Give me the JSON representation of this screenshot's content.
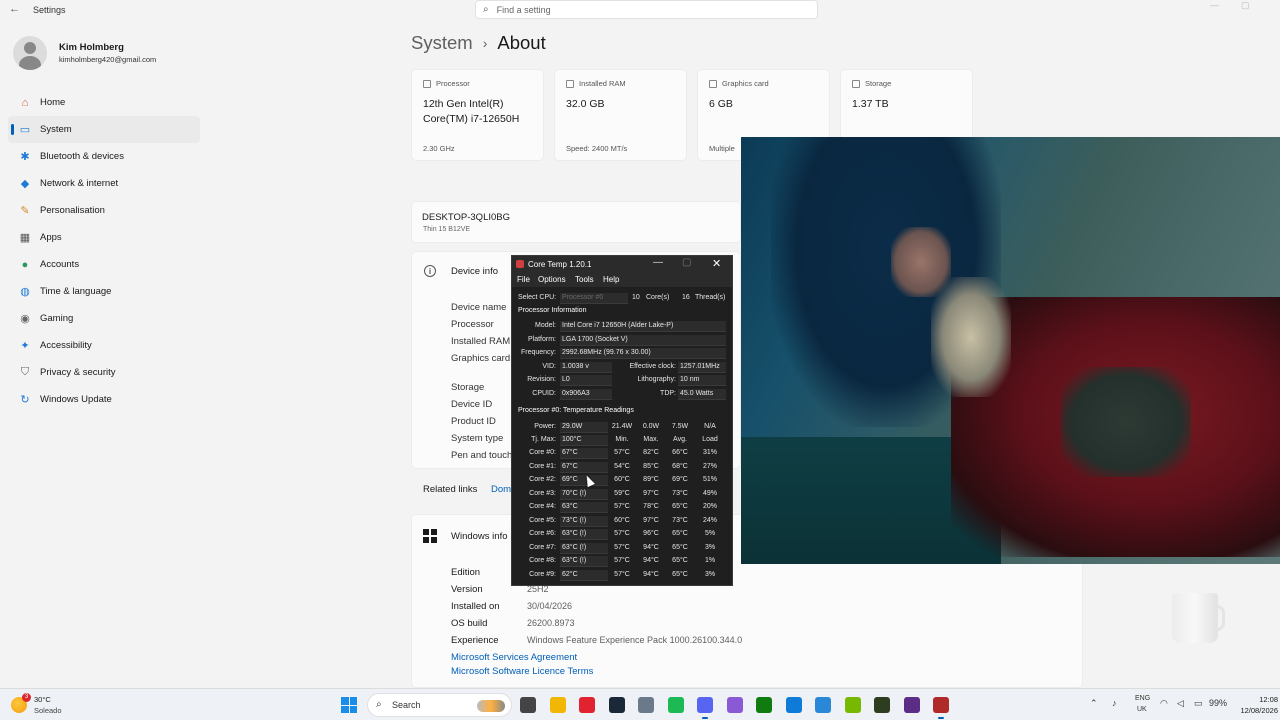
{
  "app": {
    "title": "Settings",
    "back_icon": "←"
  },
  "search": {
    "placeholder": "Find a setting"
  },
  "user": {
    "name": "Kim Holmberg",
    "email": "kimholmberg420@gmail.com"
  },
  "sidebar": {
    "items": [
      {
        "label": "Home",
        "icon": "home-icon",
        "glyph": "⌂",
        "color": "#d9623a"
      },
      {
        "label": "System",
        "icon": "system-icon",
        "glyph": "▭",
        "color": "#1f7ad6",
        "active": true
      },
      {
        "label": "Bluetooth & devices",
        "icon": "bluetooth-icon",
        "glyph": "✱",
        "color": "#1f7ad6"
      },
      {
        "label": "Network & internet",
        "icon": "network-icon",
        "glyph": "◆",
        "color": "#1f7ad6"
      },
      {
        "label": "Personalisation",
        "icon": "brush-icon",
        "glyph": "✎",
        "color": "#d08a2a"
      },
      {
        "label": "Apps",
        "icon": "apps-icon",
        "glyph": "▦",
        "color": "#555555"
      },
      {
        "label": "Accounts",
        "icon": "accounts-icon",
        "glyph": "●",
        "color": "#2a9a5a"
      },
      {
        "label": "Time & language",
        "icon": "globe-icon",
        "glyph": "◍",
        "color": "#1f7ad6"
      },
      {
        "label": "Gaming",
        "icon": "gaming-icon",
        "glyph": "◉",
        "color": "#666666"
      },
      {
        "label": "Accessibility",
        "icon": "accessibility-icon",
        "glyph": "✦",
        "color": "#1f7ad6"
      },
      {
        "label": "Privacy & security",
        "icon": "shield-icon",
        "glyph": "⛉",
        "color": "#666666"
      },
      {
        "label": "Windows Update",
        "icon": "update-icon",
        "glyph": "↻",
        "color": "#1f7ad6"
      }
    ]
  },
  "breadcrumb": {
    "parent": "System",
    "separator": "›",
    "current": "About"
  },
  "cards": [
    {
      "title": "Processor",
      "value": "12th Gen Intel(R) Core(TM) i7-12650H",
      "sub": "2.30 GHz"
    },
    {
      "title": "Installed RAM",
      "value": "32.0 GB",
      "sub": "Speed: 2400 MT/s"
    },
    {
      "title": "Graphics card",
      "value": "6 GB",
      "sub": "Multiple"
    },
    {
      "title": "Storage",
      "value": "1.37 TB",
      "sub": ""
    }
  ],
  "device": {
    "name": "DESKTOP-3QLI0BG",
    "model": "Thin 15 B12VE",
    "info_label": "Device info",
    "specs": [
      "Device name",
      "Processor",
      "Installed RAM",
      "Graphics card",
      "Storage",
      "Device ID",
      "Product ID",
      "System type",
      "Pen and touch"
    ]
  },
  "related": {
    "label": "Related links",
    "link": "Dom"
  },
  "windows_info": {
    "label": "Windows info",
    "rows": [
      {
        "label": "Edition",
        "value": ""
      },
      {
        "label": "Version",
        "value": "25H2"
      },
      {
        "label": "Installed on",
        "value": "30/04/2026"
      },
      {
        "label": "OS build",
        "value": "26200.8973"
      },
      {
        "label": "Experience",
        "value": "Windows Feature Experience Pack 1000.26100.344.0"
      }
    ],
    "links": [
      "Microsoft Services Agreement",
      "Microsoft Software Licence Terms"
    ]
  },
  "coretemp": {
    "title": "Core Temp 1.20.1",
    "menu": [
      "File",
      "Options",
      "Tools",
      "Help"
    ],
    "select_cpu_label": "Select CPU:",
    "select_cpu_value": "Processor #0",
    "cores": "10",
    "cores_label": "Core(s)",
    "threads": "16",
    "threads_label": "Thread(s)",
    "proc_info_header": "Processor Information",
    "model_label": "Model:",
    "model": "Intel Core i7 12650H (Alder Lake-P)",
    "platform_label": "Platform:",
    "platform": "LGA 1700 (Socket V)",
    "frequency_label": "Frequency:",
    "frequency": "2992.68MHz (99.76 x 30.00)",
    "vid_label": "VID:",
    "vid": "1.0038 v",
    "eff_clock_label": "Effective clock:",
    "eff_clock": "1257.01MHz",
    "revision_label": "Revision:",
    "revision": "L0",
    "litho_label": "Lithography:",
    "litho": "10 nm",
    "cpuid_label": "CPUID:",
    "cpuid": "0x906A3",
    "tdp_label": "TDP:",
    "tdp": "45.0 Watts",
    "temp_header": "Processor #0: Temperature Readings",
    "power_label": "Power:",
    "power": [
      "29.0W",
      "21.4W",
      "0.0W",
      "7.5W",
      "N/A"
    ],
    "tjmax_label": "Tj. Max:",
    "tjmax": "100°C",
    "col_headers": [
      "Min.",
      "Max.",
      "Avg.",
      "Load"
    ],
    "cores_data": [
      {
        "label": "Core #0:",
        "temp": "67°C",
        "min": "57°C",
        "max": "82°C",
        "avg": "66°C",
        "load": "31%"
      },
      {
        "label": "Core #1:",
        "temp": "67°C",
        "min": "54°C",
        "max": "85°C",
        "avg": "68°C",
        "load": "27%"
      },
      {
        "label": "Core #2:",
        "temp": "69°C",
        "min": "60°C",
        "max": "89°C",
        "avg": "69°C",
        "load": "51%"
      },
      {
        "label": "Core #3:",
        "temp": "70°C (!)",
        "min": "59°C",
        "max": "97°C",
        "avg": "73°C",
        "load": "49%"
      },
      {
        "label": "Core #4:",
        "temp": "63°C",
        "min": "57°C",
        "max": "78°C",
        "avg": "65°C",
        "load": "20%"
      },
      {
        "label": "Core #5:",
        "temp": "73°C (!)",
        "min": "60°C",
        "max": "97°C",
        "avg": "73°C",
        "load": "24%"
      },
      {
        "label": "Core #6:",
        "temp": "63°C (!)",
        "min": "57°C",
        "max": "96°C",
        "avg": "65°C",
        "load": "5%"
      },
      {
        "label": "Core #7:",
        "temp": "63°C (!)",
        "min": "57°C",
        "max": "94°C",
        "avg": "65°C",
        "load": "3%"
      },
      {
        "label": "Core #8:",
        "temp": "63°C (!)",
        "min": "57°C",
        "max": "94°C",
        "avg": "65°C",
        "load": "1%"
      },
      {
        "label": "Core #9:",
        "temp": "62°C",
        "min": "57°C",
        "max": "94°C",
        "avg": "65°C",
        "load": "3%"
      }
    ]
  },
  "taskbar": {
    "weather_temp": "30°C",
    "weather_desc": "Soleado",
    "weather_badge": "3",
    "search_label": "Search",
    "apps": [
      {
        "name": "file-manager-icon",
        "color": "#444444"
      },
      {
        "name": "folder-icon",
        "color": "#f2b705"
      },
      {
        "name": "opera-icon",
        "color": "#e0232e"
      },
      {
        "name": "steam-icon",
        "color": "#1b2838"
      },
      {
        "name": "settings-icon",
        "color": "#6b7a8a"
      },
      {
        "name": "spotify-icon",
        "color": "#1db954"
      },
      {
        "name": "discord-icon",
        "color": "#5865f2"
      },
      {
        "name": "snip-icon",
        "color": "#8a5ad6"
      },
      {
        "name": "xbox-icon",
        "color": "#107c10"
      },
      {
        "name": "edge-icon",
        "color": "#0f7bd8"
      },
      {
        "name": "photos-icon",
        "color": "#2b88d8"
      },
      {
        "name": "nvidia-icon",
        "color": "#76b900"
      },
      {
        "name": "terminal-icon",
        "color": "#2c3e1f"
      },
      {
        "name": "obs-icon",
        "color": "#5b2d86"
      },
      {
        "name": "coretemp-icon",
        "color": "#b02a2a"
      }
    ],
    "lang_top": "ENG",
    "lang_bottom": "UK",
    "battery": "99%",
    "time": "12:08",
    "date": "12/08/2026"
  }
}
